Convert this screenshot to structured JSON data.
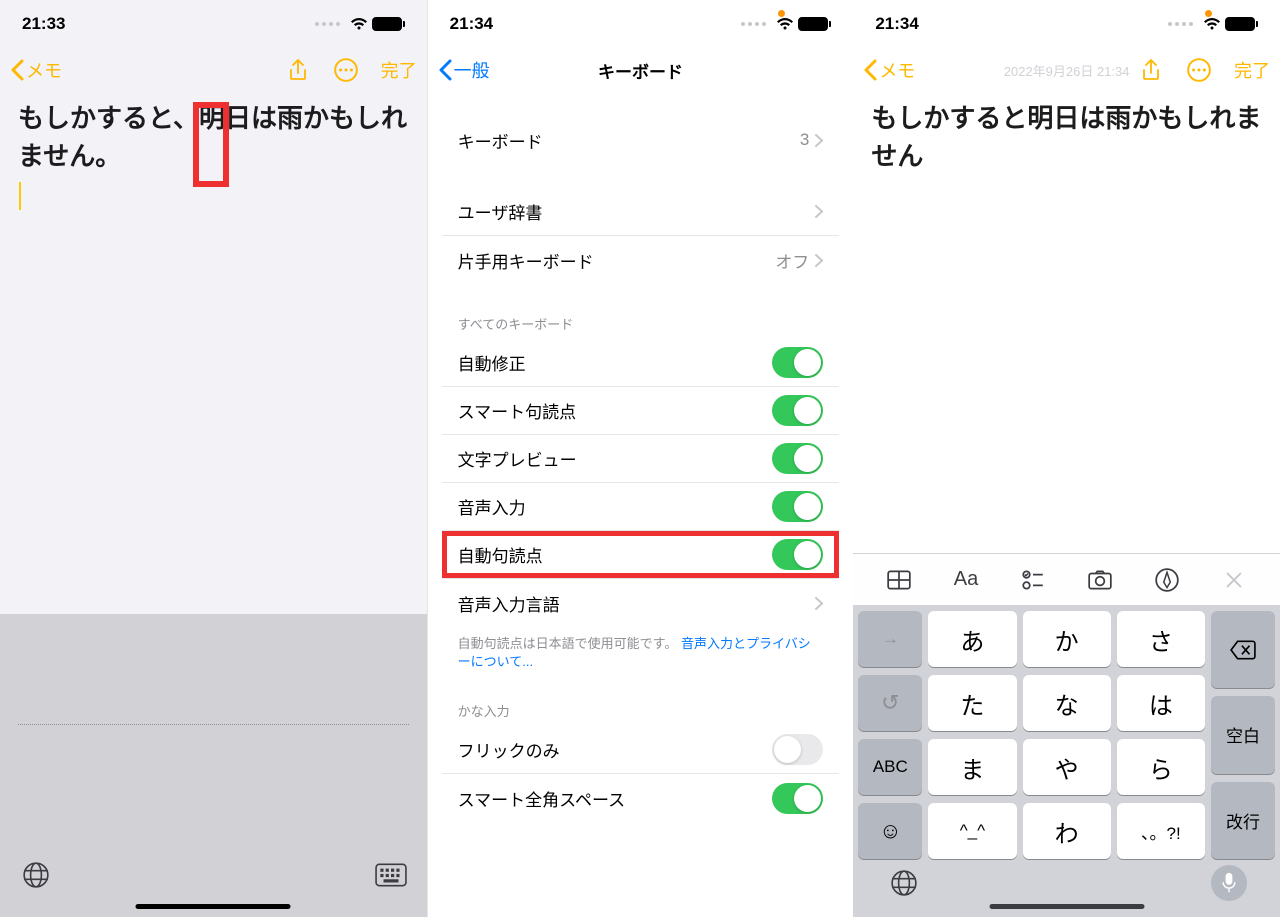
{
  "screen1": {
    "time": "21:33",
    "back_label": "メモ",
    "done": "完了",
    "note_text": "もしかすると、明日は雨かもしれません。"
  },
  "screen2": {
    "time": "21:34",
    "back_label": "一般",
    "title": "キーボード",
    "keyboards_label": "キーボード",
    "keyboards_count": "3",
    "user_dict": "ユーザ辞書",
    "one_handed": "片手用キーボード",
    "one_handed_value": "オフ",
    "header_all": "すべてのキーボード",
    "auto_correct": "自動修正",
    "smart_punct": "スマート句読点",
    "char_preview": "文字プレビュー",
    "dictation": "音声入力",
    "auto_punct": "自動句読点",
    "dictation_lang": "音声入力言語",
    "footer_text": "自動句読点は日本語で使用可能です。",
    "footer_link": "音声入力とプライバシーについて...",
    "header_kana": "かな入力",
    "flick_only": "フリックのみ",
    "smart_fullwidth": "スマート全角スペース"
  },
  "screen3": {
    "time": "21:34",
    "back_label": "メモ",
    "done": "完了",
    "note_text": "もしかすると明日は雨かもしれません",
    "note_meta": "2022年9月26日 21:34",
    "acc_aa": "Aa",
    "keys": {
      "arrow": "→",
      "a": "あ",
      "ka": "か",
      "sa": "さ",
      "undo": "↺",
      "ta": "た",
      "na": "な",
      "ha": "は",
      "space": "空白",
      "abc": "ABC",
      "ma": "ま",
      "ya": "や",
      "ra": "ら",
      "return": "改行",
      "emoji": "☺",
      "small": "^_^",
      "wa": "わ",
      "punct": "、。?!"
    }
  }
}
